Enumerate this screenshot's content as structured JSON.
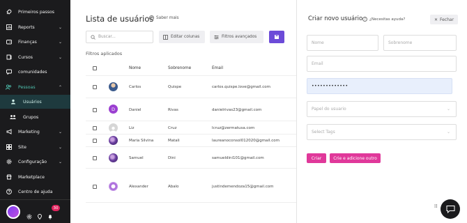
{
  "sidebar": {
    "items": [
      {
        "label": "Primeiros passos",
        "icon": "rocket-icon",
        "chevron": false
      },
      {
        "label": "Reports",
        "icon": "chart-icon",
        "chevron": true
      },
      {
        "label": "Finanças",
        "icon": "wallet-icon",
        "chevron": true
      },
      {
        "label": "Cursos",
        "icon": "book-icon",
        "chevron": true
      },
      {
        "label": "comunidades",
        "icon": "community-icon",
        "chevron": false
      },
      {
        "label": "Pessoas",
        "icon": "people-icon",
        "chevron": true,
        "expanded": true
      },
      {
        "label": "Usuários",
        "icon": "user-icon",
        "sub": true,
        "active": true
      },
      {
        "label": "Grupos",
        "icon": "group-icon",
        "sub": true
      },
      {
        "label": "Marketing",
        "icon": "megaphone-icon",
        "chevron": true
      },
      {
        "label": "Site",
        "icon": "site-icon",
        "chevron": true
      },
      {
        "label": "Configuração",
        "icon": "settings-icon",
        "chevron": true
      },
      {
        "label": "Marketplace",
        "icon": "store-icon",
        "chevron": false
      },
      {
        "label": "Centro de ajuda",
        "icon": "help-icon",
        "chevron": false
      }
    ],
    "notifications_count": "30"
  },
  "main": {
    "title": "Lista de usuários",
    "saber_mais": "Saber mais",
    "search_placeholder": "Buscar...",
    "edit_columns": "Editar colunas",
    "advanced_filters": "Filtros avançados",
    "filters_applied": "Filtros aplicados",
    "columns": {
      "name": "Nome",
      "surname": "Sobrenome",
      "email": "Email"
    },
    "rows": [
      {
        "name": "Carlos",
        "surname": "Quispe",
        "email": "carlos.quispe.love@gmail.com",
        "avatar": "photo",
        "color": "#3b5a8c"
      },
      {
        "name": "Daniel",
        "surname": "Rivas",
        "email": "danielrivas23@gmail.com",
        "avatar": "D",
        "color": "#9b3fd1"
      },
      {
        "name": "Liz",
        "surname": "Cruz",
        "email": "lcruz@zermatusa.com",
        "avatar": "generic",
        "color": "#d6d6d6"
      },
      {
        "name": "Maria Silvina",
        "surname": "Matali",
        "email": "laureanoconsol012020@gmail.com",
        "avatar": "photo",
        "color": "#6a3fa0"
      },
      {
        "name": "Samuel",
        "surname": "Dini",
        "email": "samueldini101@gmail.com",
        "avatar": "photo",
        "color": "#6a3fa0"
      },
      {
        "name": "Alexander",
        "surname": "Abalo",
        "email": "justindemendoza15@gmail.com",
        "avatar": "photo",
        "color": "#a35fd8"
      }
    ]
  },
  "panel": {
    "title": "Criar novo usuário",
    "help": "¿Necesitas ayuda?",
    "close": "Fechar",
    "name_placeholder": "Nome",
    "surname_placeholder": "Sobrenome",
    "email_placeholder": "Email",
    "password_value": "•••••••••••••",
    "role_placeholder": "Papel do usuario",
    "tags_placeholder": "Select Tags",
    "create": "Criar",
    "create_add_other": "Crie e adicione outro"
  },
  "colors": {
    "sidebar_bg": "#1b1b1d",
    "accent_purple": "#6c4bd8",
    "accent_pink": "#e0389a",
    "active_bg": "#1e3a3e"
  }
}
